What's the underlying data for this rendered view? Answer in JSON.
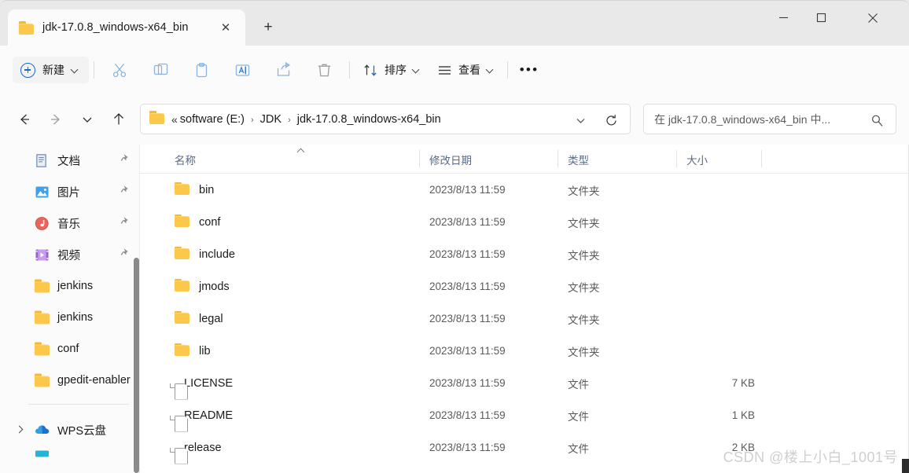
{
  "window": {
    "tab_title": "jdk-17.0.8_windows-x64_bin",
    "tab_close_glyph": "✕",
    "new_tab_glyph": "+",
    "minimize_glyph": "—",
    "maximize_glyph": "□",
    "close_glyph": "✕"
  },
  "toolbar": {
    "new_label": "新建",
    "sort_label": "排序",
    "view_label": "查看",
    "more_label": "•••",
    "icons": [
      "cut-icon",
      "copy-icon",
      "paste-icon",
      "rename-icon",
      "share-icon",
      "delete-icon"
    ]
  },
  "navigation": {
    "back_glyph": "←",
    "forward_glyph": "→",
    "recent_glyph": "⌄",
    "up_glyph": "↑"
  },
  "address": {
    "overflow_glyph": "«",
    "crumbs": [
      "software (E:)",
      "JDK",
      "jdk-17.0.8_windows-x64_bin"
    ],
    "separator": "›",
    "dropdown_glyph": "⌄",
    "refresh_glyph": "↻"
  },
  "search": {
    "placeholder": "在 jdk-17.0.8_windows-x64_bin 中...",
    "icon": "search-icon"
  },
  "sidebar": {
    "items": [
      {
        "label": "文档",
        "icon": "documents-icon",
        "pinned": true
      },
      {
        "label": "图片",
        "icon": "pictures-icon",
        "pinned": true
      },
      {
        "label": "音乐",
        "icon": "music-icon",
        "pinned": true
      },
      {
        "label": "视频",
        "icon": "videos-icon",
        "pinned": true
      },
      {
        "label": "jenkins",
        "icon": "folder-icon",
        "pinned": false
      },
      {
        "label": "jenkins",
        "icon": "folder-icon",
        "pinned": false
      },
      {
        "label": "conf",
        "icon": "folder-icon",
        "pinned": false
      },
      {
        "label": "gpedit-enabler",
        "icon": "folder-icon",
        "pinned": false
      }
    ],
    "cloud": {
      "label": "WPS云盘",
      "icon": "cloud-icon",
      "expandable": true
    },
    "pin_glyph": "📌"
  },
  "filelist": {
    "columns": [
      {
        "key": "name",
        "label": "名称"
      },
      {
        "key": "date",
        "label": "修改日期"
      },
      {
        "key": "type",
        "label": "类型"
      },
      {
        "key": "size",
        "label": "大小"
      }
    ],
    "sort_column": "名称",
    "sort_direction": "ascending",
    "rows": [
      {
        "name": "bin",
        "date": "2023/8/13 11:59",
        "type": "文件夹",
        "size": "",
        "icon": "folder-icon"
      },
      {
        "name": "conf",
        "date": "2023/8/13 11:59",
        "type": "文件夹",
        "size": "",
        "icon": "folder-icon"
      },
      {
        "name": "include",
        "date": "2023/8/13 11:59",
        "type": "文件夹",
        "size": "",
        "icon": "folder-icon"
      },
      {
        "name": "jmods",
        "date": "2023/8/13 11:59",
        "type": "文件夹",
        "size": "",
        "icon": "folder-icon"
      },
      {
        "name": "legal",
        "date": "2023/8/13 11:59",
        "type": "文件夹",
        "size": "",
        "icon": "folder-icon"
      },
      {
        "name": "lib",
        "date": "2023/8/13 11:59",
        "type": "文件夹",
        "size": "",
        "icon": "folder-icon"
      },
      {
        "name": "LICENSE",
        "date": "2023/8/13 11:59",
        "type": "文件",
        "size": "7 KB",
        "icon": "file-icon"
      },
      {
        "name": "README",
        "date": "2023/8/13 11:59",
        "type": "文件",
        "size": "1 KB",
        "icon": "file-icon"
      },
      {
        "name": "release",
        "date": "2023/8/13 11:59",
        "type": "文件",
        "size": "2 KB",
        "icon": "file-icon"
      }
    ]
  },
  "watermark": {
    "text": "CSDN @楼上小白_1001号"
  },
  "colors": {
    "accent": "#1769c7",
    "folder_yellow": "#fcc84c",
    "titlebar": "#e9e9e9",
    "toolbar": "#fbfbfb",
    "header_text": "#5b6b85"
  }
}
